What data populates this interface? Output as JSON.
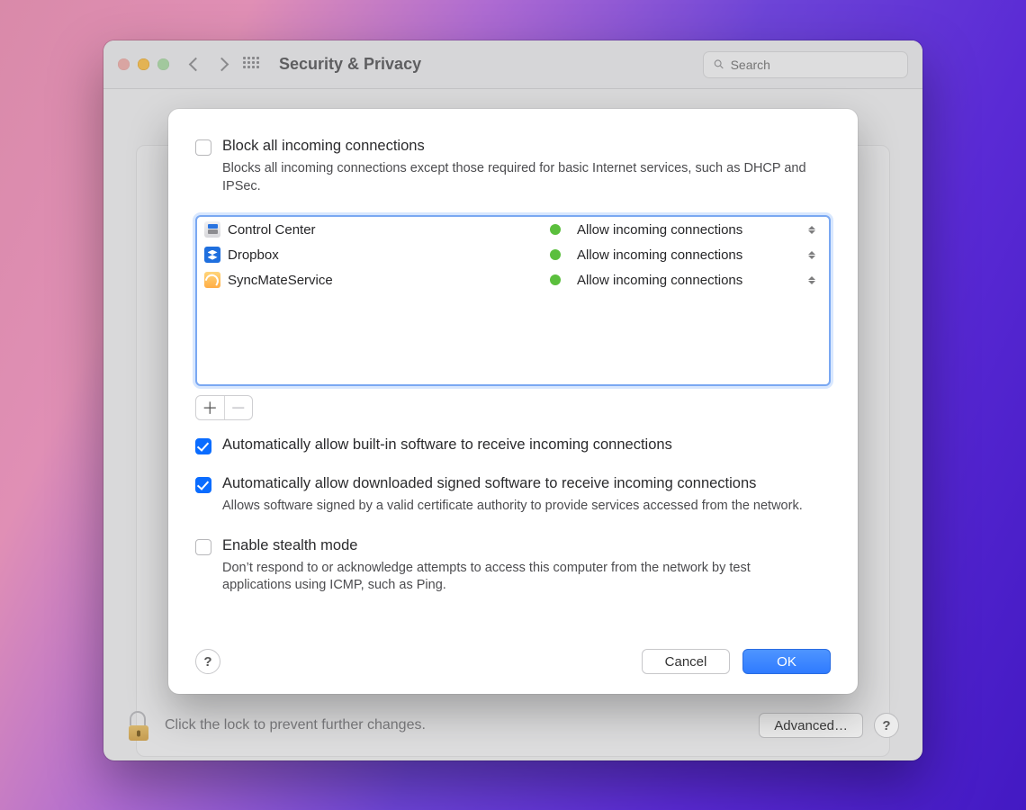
{
  "window": {
    "title": "Security & Privacy",
    "search_placeholder": "Search"
  },
  "lock_text": "Click the lock to prevent further changes.",
  "advanced_label": "Advanced…",
  "sheet": {
    "block_all": {
      "label": "Block all incoming connections",
      "desc": "Blocks all incoming connections except those required for basic Internet services, such as DHCP and IPSec.",
      "checked": false
    },
    "apps": [
      {
        "name": "Control Center",
        "status": "Allow incoming connections",
        "icon": "ic-cc"
      },
      {
        "name": "Dropbox",
        "status": "Allow incoming connections",
        "icon": "ic-db"
      },
      {
        "name": "SyncMateService",
        "status": "Allow incoming connections",
        "icon": "ic-sm"
      }
    ],
    "auto_builtin": {
      "label": "Automatically allow built-in software to receive incoming connections",
      "checked": true
    },
    "auto_signed": {
      "label": "Automatically allow downloaded signed software to receive incoming connections",
      "desc": "Allows software signed by a valid certificate authority to provide services accessed from the network.",
      "checked": true
    },
    "stealth": {
      "label": "Enable stealth mode",
      "desc": "Don’t respond to or acknowledge attempts to access this computer from the network by test applications using ICMP, such as Ping.",
      "checked": false
    },
    "cancel_label": "Cancel",
    "ok_label": "OK"
  }
}
